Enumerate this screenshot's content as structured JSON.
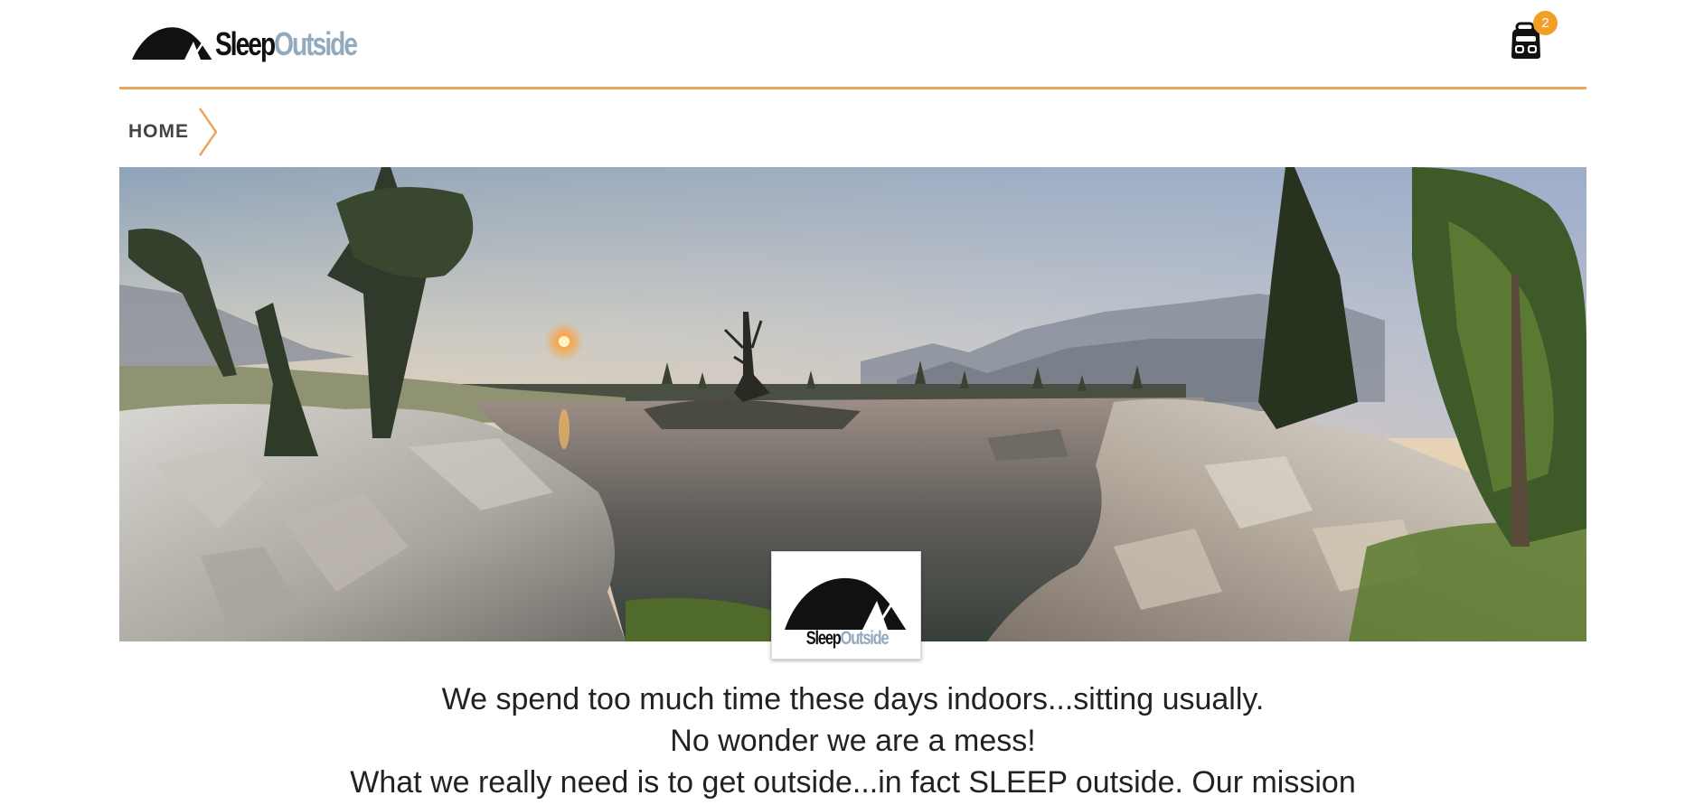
{
  "header": {
    "logo": {
      "part1": "Sleep",
      "part2": "Outside"
    },
    "cart": {
      "count": "2"
    }
  },
  "breadcrumb": {
    "items": [
      "HOME"
    ]
  },
  "hero": {
    "badge": {
      "part1": "Sleep",
      "part2": "Outside"
    }
  },
  "mission": {
    "lines": [
      "We spend too much time these days indoors...sitting usually.",
      "No wonder we are a mess!",
      "What we really need is to get outside...in fact SLEEP outside. Our mission"
    ]
  },
  "colors": {
    "accent_border": "#e9a65d",
    "badge": "#f0a024",
    "logo_dark": "#111111",
    "logo_blue": "#93a9be"
  }
}
